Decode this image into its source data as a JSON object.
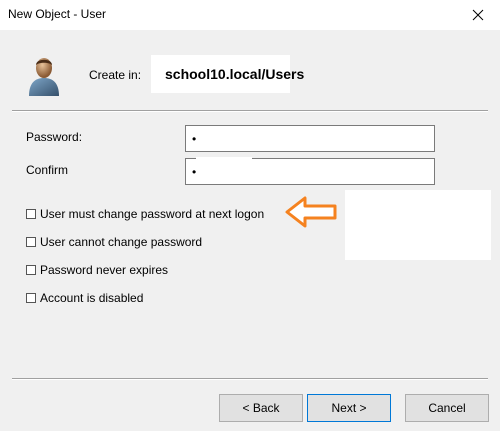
{
  "window": {
    "title": "New Object - User",
    "close_icon": "close-icon"
  },
  "header": {
    "icon": "user-icon",
    "create_in_label": "Create in:",
    "create_in_value": "school10.local/Users"
  },
  "form": {
    "password_label": "Password:",
    "password_value": "•",
    "confirm_label": "Confirm",
    "confirm_value": "•"
  },
  "options": [
    {
      "label": "User must change password at next logon",
      "checked": false
    },
    {
      "label": "User cannot change password",
      "checked": false
    },
    {
      "label": "Password never expires",
      "checked": false
    },
    {
      "label": "Account is disabled",
      "checked": false
    }
  ],
  "annotation": {
    "arrow_color": "#f5821f",
    "icon": "left-arrow-icon"
  },
  "buttons": {
    "back": "< Back",
    "next": "Next >",
    "cancel": "Cancel"
  }
}
